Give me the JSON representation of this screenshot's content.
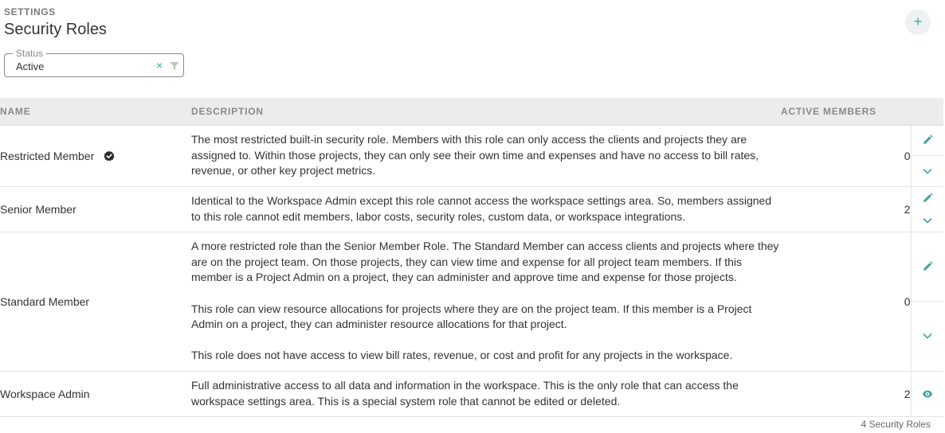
{
  "header": {
    "eyebrow": "SETTINGS",
    "title": "Security Roles",
    "add_icon": "plus-icon"
  },
  "filter": {
    "legend": "Status",
    "value": "Active",
    "clear_icon": "×"
  },
  "table": {
    "columns": {
      "name": "NAME",
      "description": "DESCRIPTION",
      "count": "ACTIVE MEMBERS"
    },
    "rows": [
      {
        "name": "Restricted Member",
        "badge": "verified-badge-icon",
        "description": [
          "The most restricted built-in security role. Members with this role can only access the clients and projects they are assigned to. Within those projects, they can only see their own time and expenses and have no access to bill rates, revenue, or other key project metrics."
        ],
        "count": "0",
        "actions": [
          "edit-icon",
          "chevron-down-icon"
        ]
      },
      {
        "name": "Senior Member",
        "description": [
          "Identical to the Workspace Admin except this role cannot access the workspace settings area. So, members assigned to this role cannot edit members, labor costs, security roles, custom data, or workspace integrations."
        ],
        "count": "2",
        "actions": [
          "edit-icon",
          "chevron-down-icon"
        ]
      },
      {
        "name": "Standard Member",
        "description": [
          "A more restricted role than the Senior Member Role. The Standard Member can access clients and projects where they are on the project team. On those projects, they can view time and expense for all project team members. If this member is a Project Admin on a project, they can administer and approve time and expense for those projects.",
          "This role can view resource allocations for projects where they are on the project team. If this member is a Project Admin on a project, they can administer resource allocations for that project.",
          "This role does not have access to view bill rates, revenue, or cost and profit for any projects in the workspace."
        ],
        "count": "0",
        "actions": [
          "edit-icon",
          "chevron-down-icon"
        ]
      },
      {
        "name": "Workspace Admin",
        "description": [
          "Full administrative access to all data and information in the workspace. This is the only role that can access the workspace settings area. This is a special system role that cannot be edited or deleted."
        ],
        "count": "2",
        "actions": [
          "view-icon"
        ]
      }
    ]
  },
  "footer": {
    "count_label": "4 Security Roles"
  },
  "colors": {
    "accent": "#3fa7a0",
    "header_bg": "#ececec",
    "text": "#333333",
    "muted": "#8a8a8a"
  }
}
